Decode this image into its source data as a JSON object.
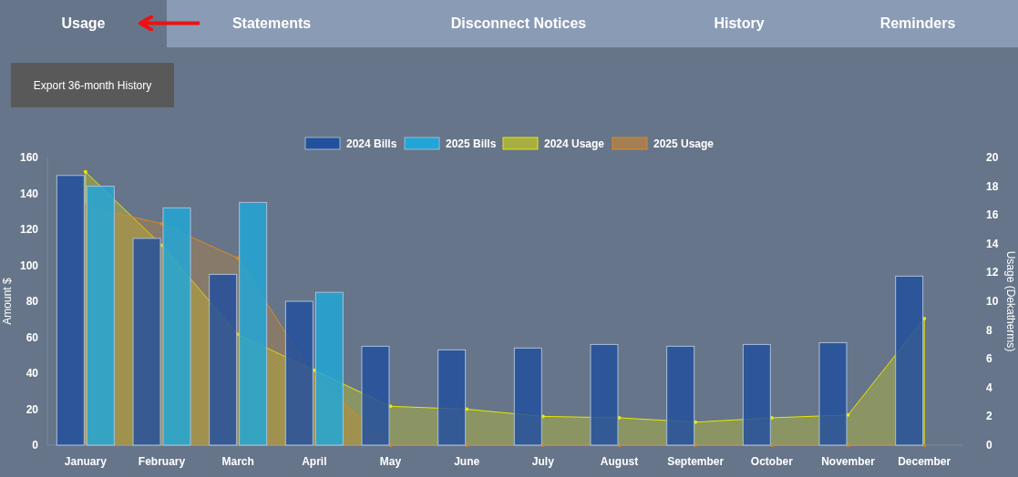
{
  "tabs": [
    {
      "label": "Usage",
      "selected": true
    },
    {
      "label": "Statements",
      "selected": false
    },
    {
      "label": "Disconnect Notices",
      "selected": false
    },
    {
      "label": "History",
      "selected": false
    },
    {
      "label": "Reminders",
      "selected": false
    }
  ],
  "export_button": "Export 36-month History",
  "bills_chart": {
    "chart_data": {
      "type": "bar",
      "ylabel": "Amount $",
      "legend": "top",
      "categories": [
        "January",
        "February",
        "March",
        "April",
        "May",
        "June",
        "July",
        "August",
        "September",
        "October",
        "November",
        "December"
      ],
      "series": [
        {
          "name": "2024 Bills",
          "color": "#23509c",
          "values": [
            150,
            115,
            95,
            80,
            55,
            53,
            54,
            56,
            55,
            56,
            57,
            94
          ]
        },
        {
          "name": "2025 Bills",
          "color": "#22a6d6",
          "values": [
            144,
            132,
            135,
            85,
            null,
            null,
            null,
            null,
            null,
            null,
            null,
            null
          ]
        }
      ],
      "ylim": [
        0,
        160
      ],
      "yticks": [
        0,
        20,
        40,
        60,
        80,
        100,
        120,
        140,
        160
      ]
    }
  },
  "usage_chart": {
    "chart_data": {
      "type": "area",
      "ylabel": "Usage (Dekatherms)",
      "legend": "top",
      "series": [
        {
          "name": "2024 Usage",
          "color": "#e8e800",
          "values": [
            19,
            13.9,
            7.7,
            5.2,
            2.7,
            2.5,
            2,
            1.9,
            1.6,
            1.9,
            2.1,
            8.8
          ]
        },
        {
          "name": "2025 Usage",
          "color": "#e08a1e",
          "values": [
            16.6,
            15.4,
            13,
            4.7,
            0,
            0,
            0,
            0,
            0,
            0,
            0,
            0
          ]
        }
      ],
      "ylim": [
        0,
        20
      ],
      "yticks": [
        0,
        2,
        4,
        6,
        8,
        10,
        12,
        14,
        16,
        18,
        20
      ]
    }
  }
}
